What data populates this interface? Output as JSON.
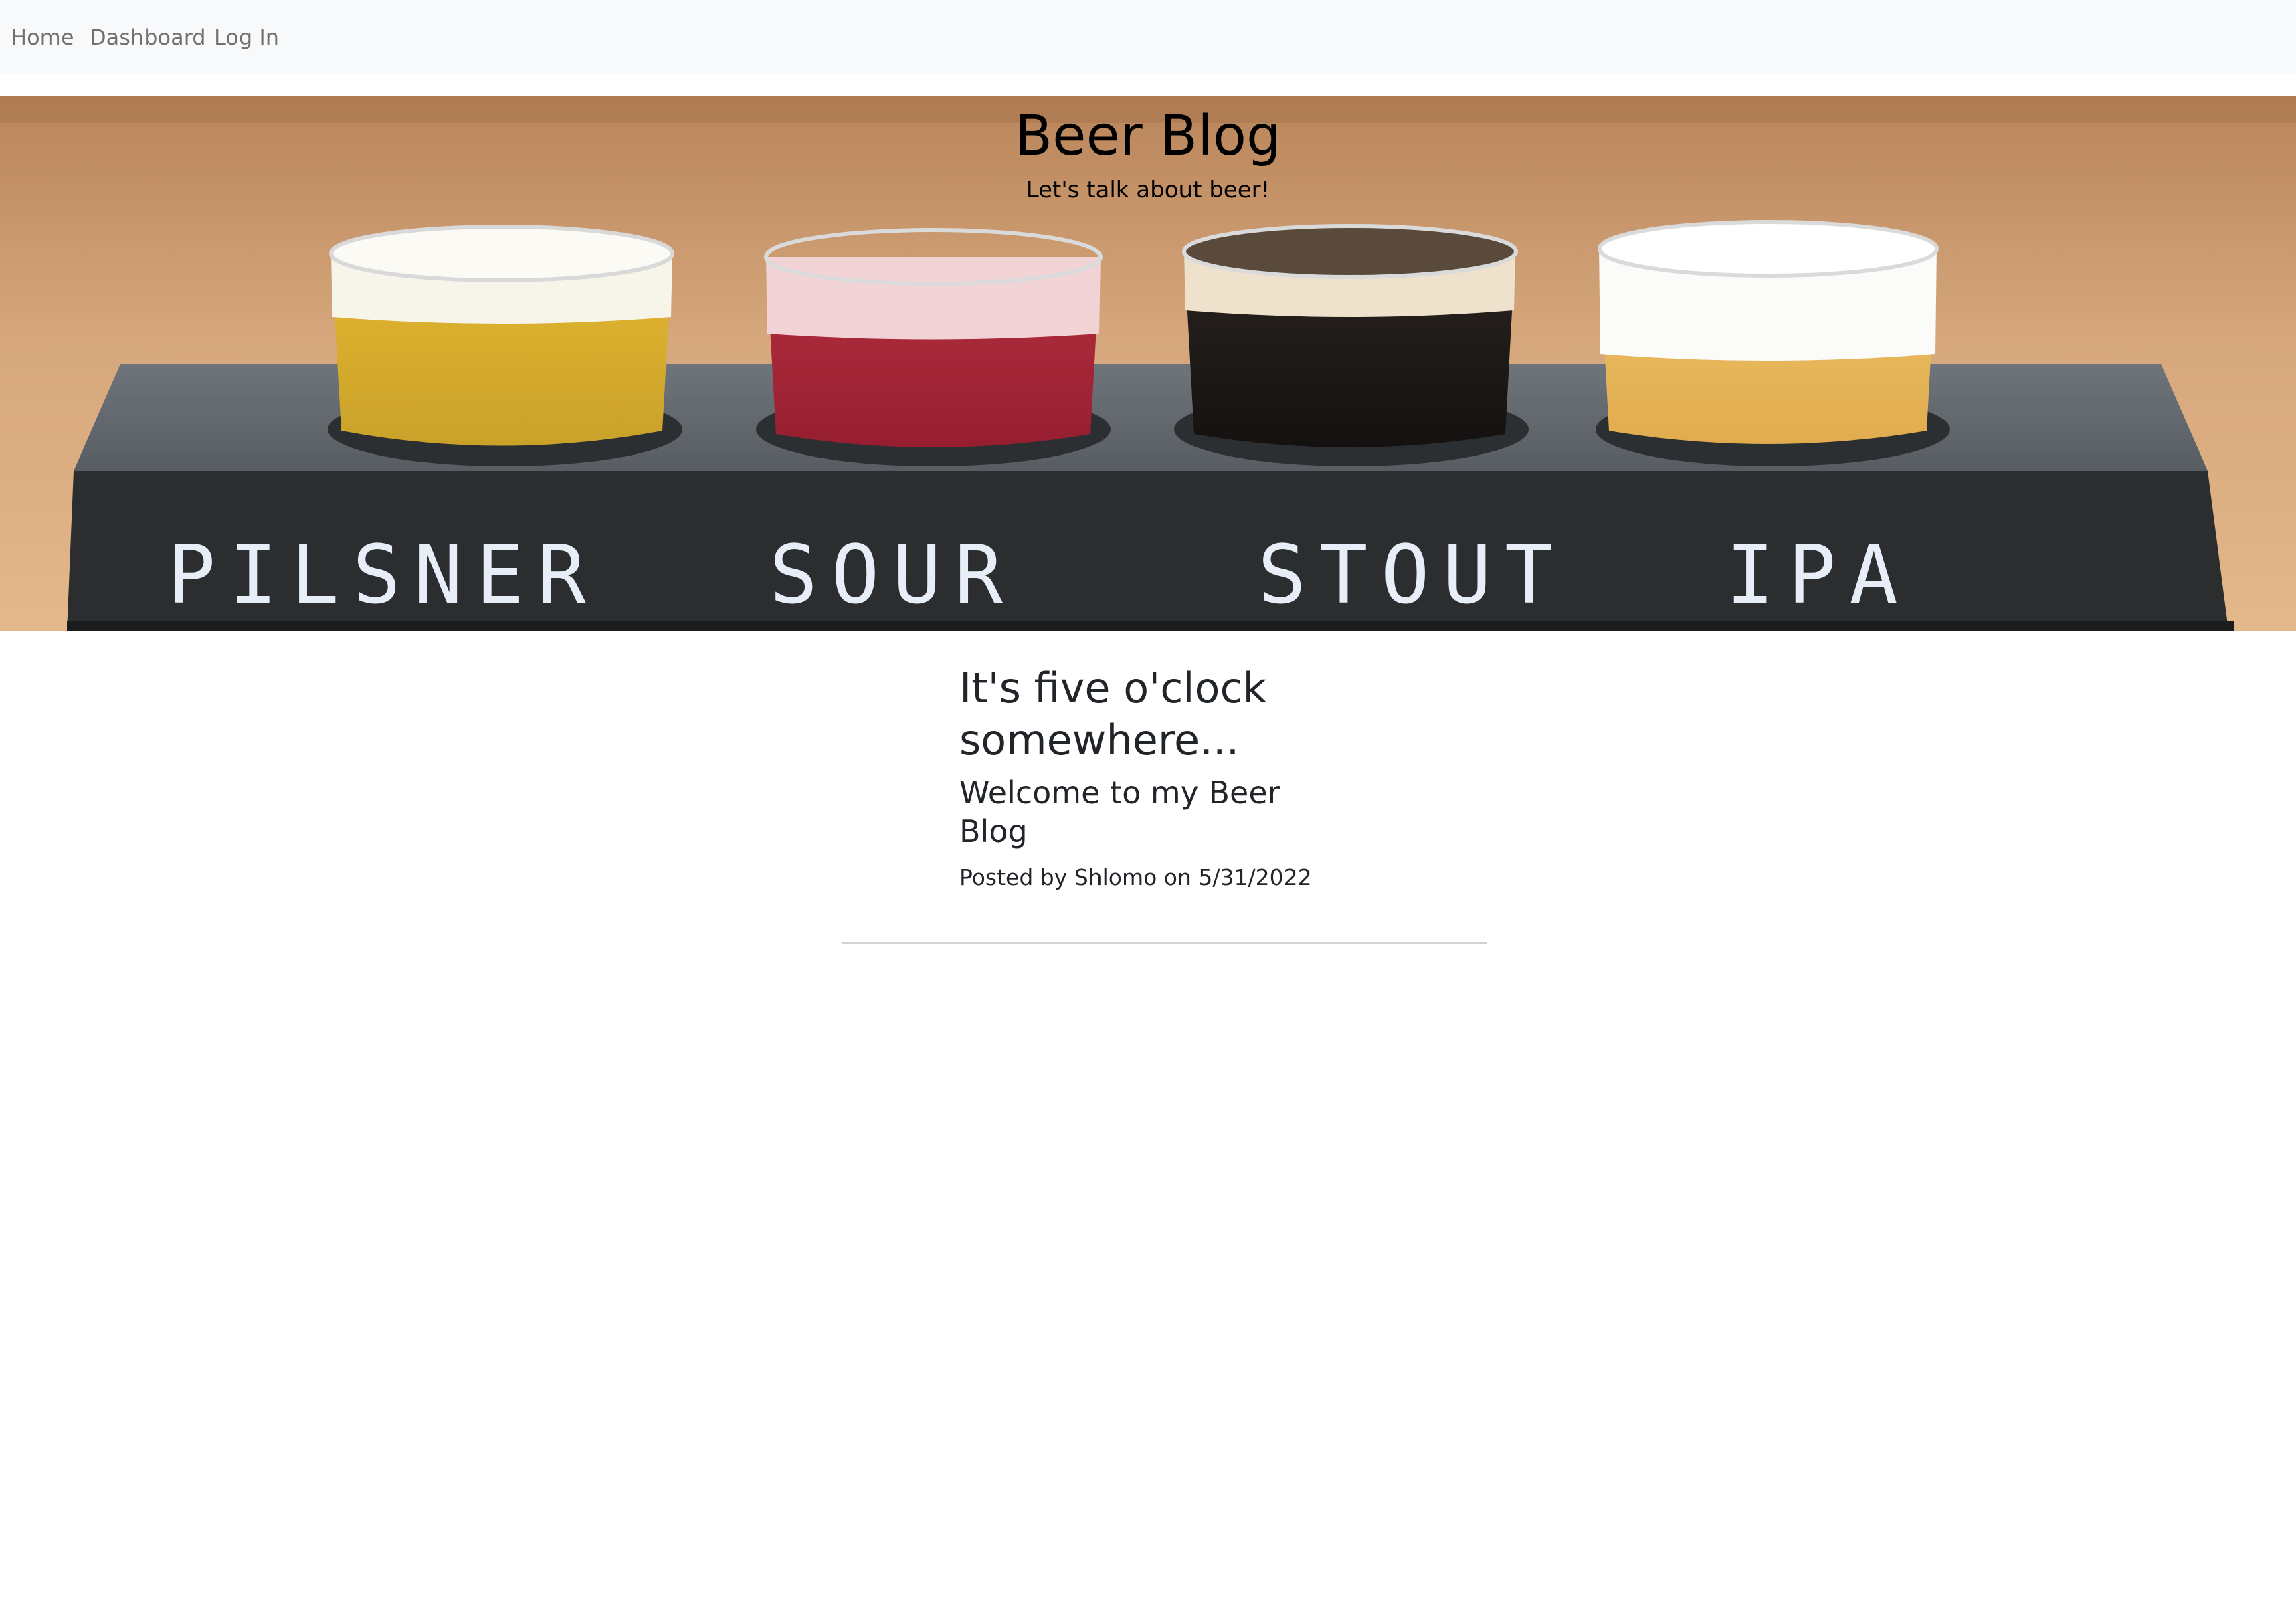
{
  "navbar": {
    "links": [
      {
        "label": "Home"
      },
      {
        "label": "Dashboard"
      },
      {
        "label": "Log In"
      }
    ]
  },
  "hero": {
    "title": "Beer Blog",
    "subtitle": "Let's talk about beer!",
    "flight_labels": [
      "PILSNER",
      "SOUR",
      "STOUT",
      "IPA"
    ]
  },
  "post": {
    "title": "It's five o'clock somewhere...",
    "subtitle": "Welcome to my Beer Blog",
    "meta": "Posted by Shlomo on 5/31/2022"
  },
  "colors": {
    "navbar_bg": "#f8f9fa",
    "nav_link": "#6c757d",
    "text": "#212529",
    "pilsner": "#d9b32a",
    "sour": "#a8283a",
    "stout": "#1d1a18",
    "ipa": "#e9b85a"
  }
}
